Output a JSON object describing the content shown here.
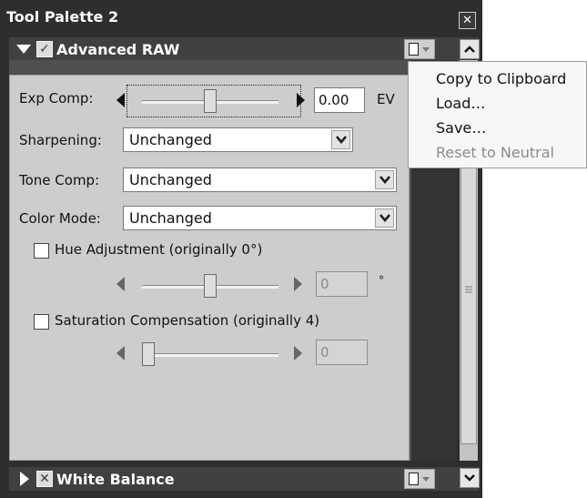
{
  "window": {
    "title": "Tool Palette 2",
    "close_glyph": "✕"
  },
  "section_advanced": {
    "title": "Advanced RAW",
    "check_glyph": "✓",
    "exp_comp": {
      "label": "Exp Comp:",
      "value": "0.00",
      "unit": "EV",
      "slider_position": 0.5
    },
    "sharpening": {
      "label": "Sharpening:",
      "value": "Unchanged"
    },
    "tone_comp": {
      "label": "Tone Comp:",
      "value": "Unchanged"
    },
    "color_mode": {
      "label": "Color Mode:",
      "value": "Unchanged"
    },
    "hue": {
      "label": "Hue Adjustment (originally 0°)",
      "value": "0",
      "unit": "°",
      "checked": false,
      "slider_position": 0.5
    },
    "saturation": {
      "label": "Saturation Compensation (originally 4)",
      "value": "0",
      "checked": false,
      "slider_position": 0.0
    }
  },
  "section_white_balance": {
    "title": "White Balance",
    "check_glyph": "✕"
  },
  "context_menu": {
    "items": [
      {
        "label": "Copy to Clipboard",
        "enabled": true
      },
      {
        "label": "Load…",
        "enabled": true
      },
      {
        "label": "Save…",
        "enabled": true
      },
      {
        "label": "Reset to Neutral",
        "enabled": false
      }
    ]
  },
  "colors": {
    "frame": "#2e2e2e",
    "panel": "#cdcdcd",
    "header": "#404040"
  }
}
